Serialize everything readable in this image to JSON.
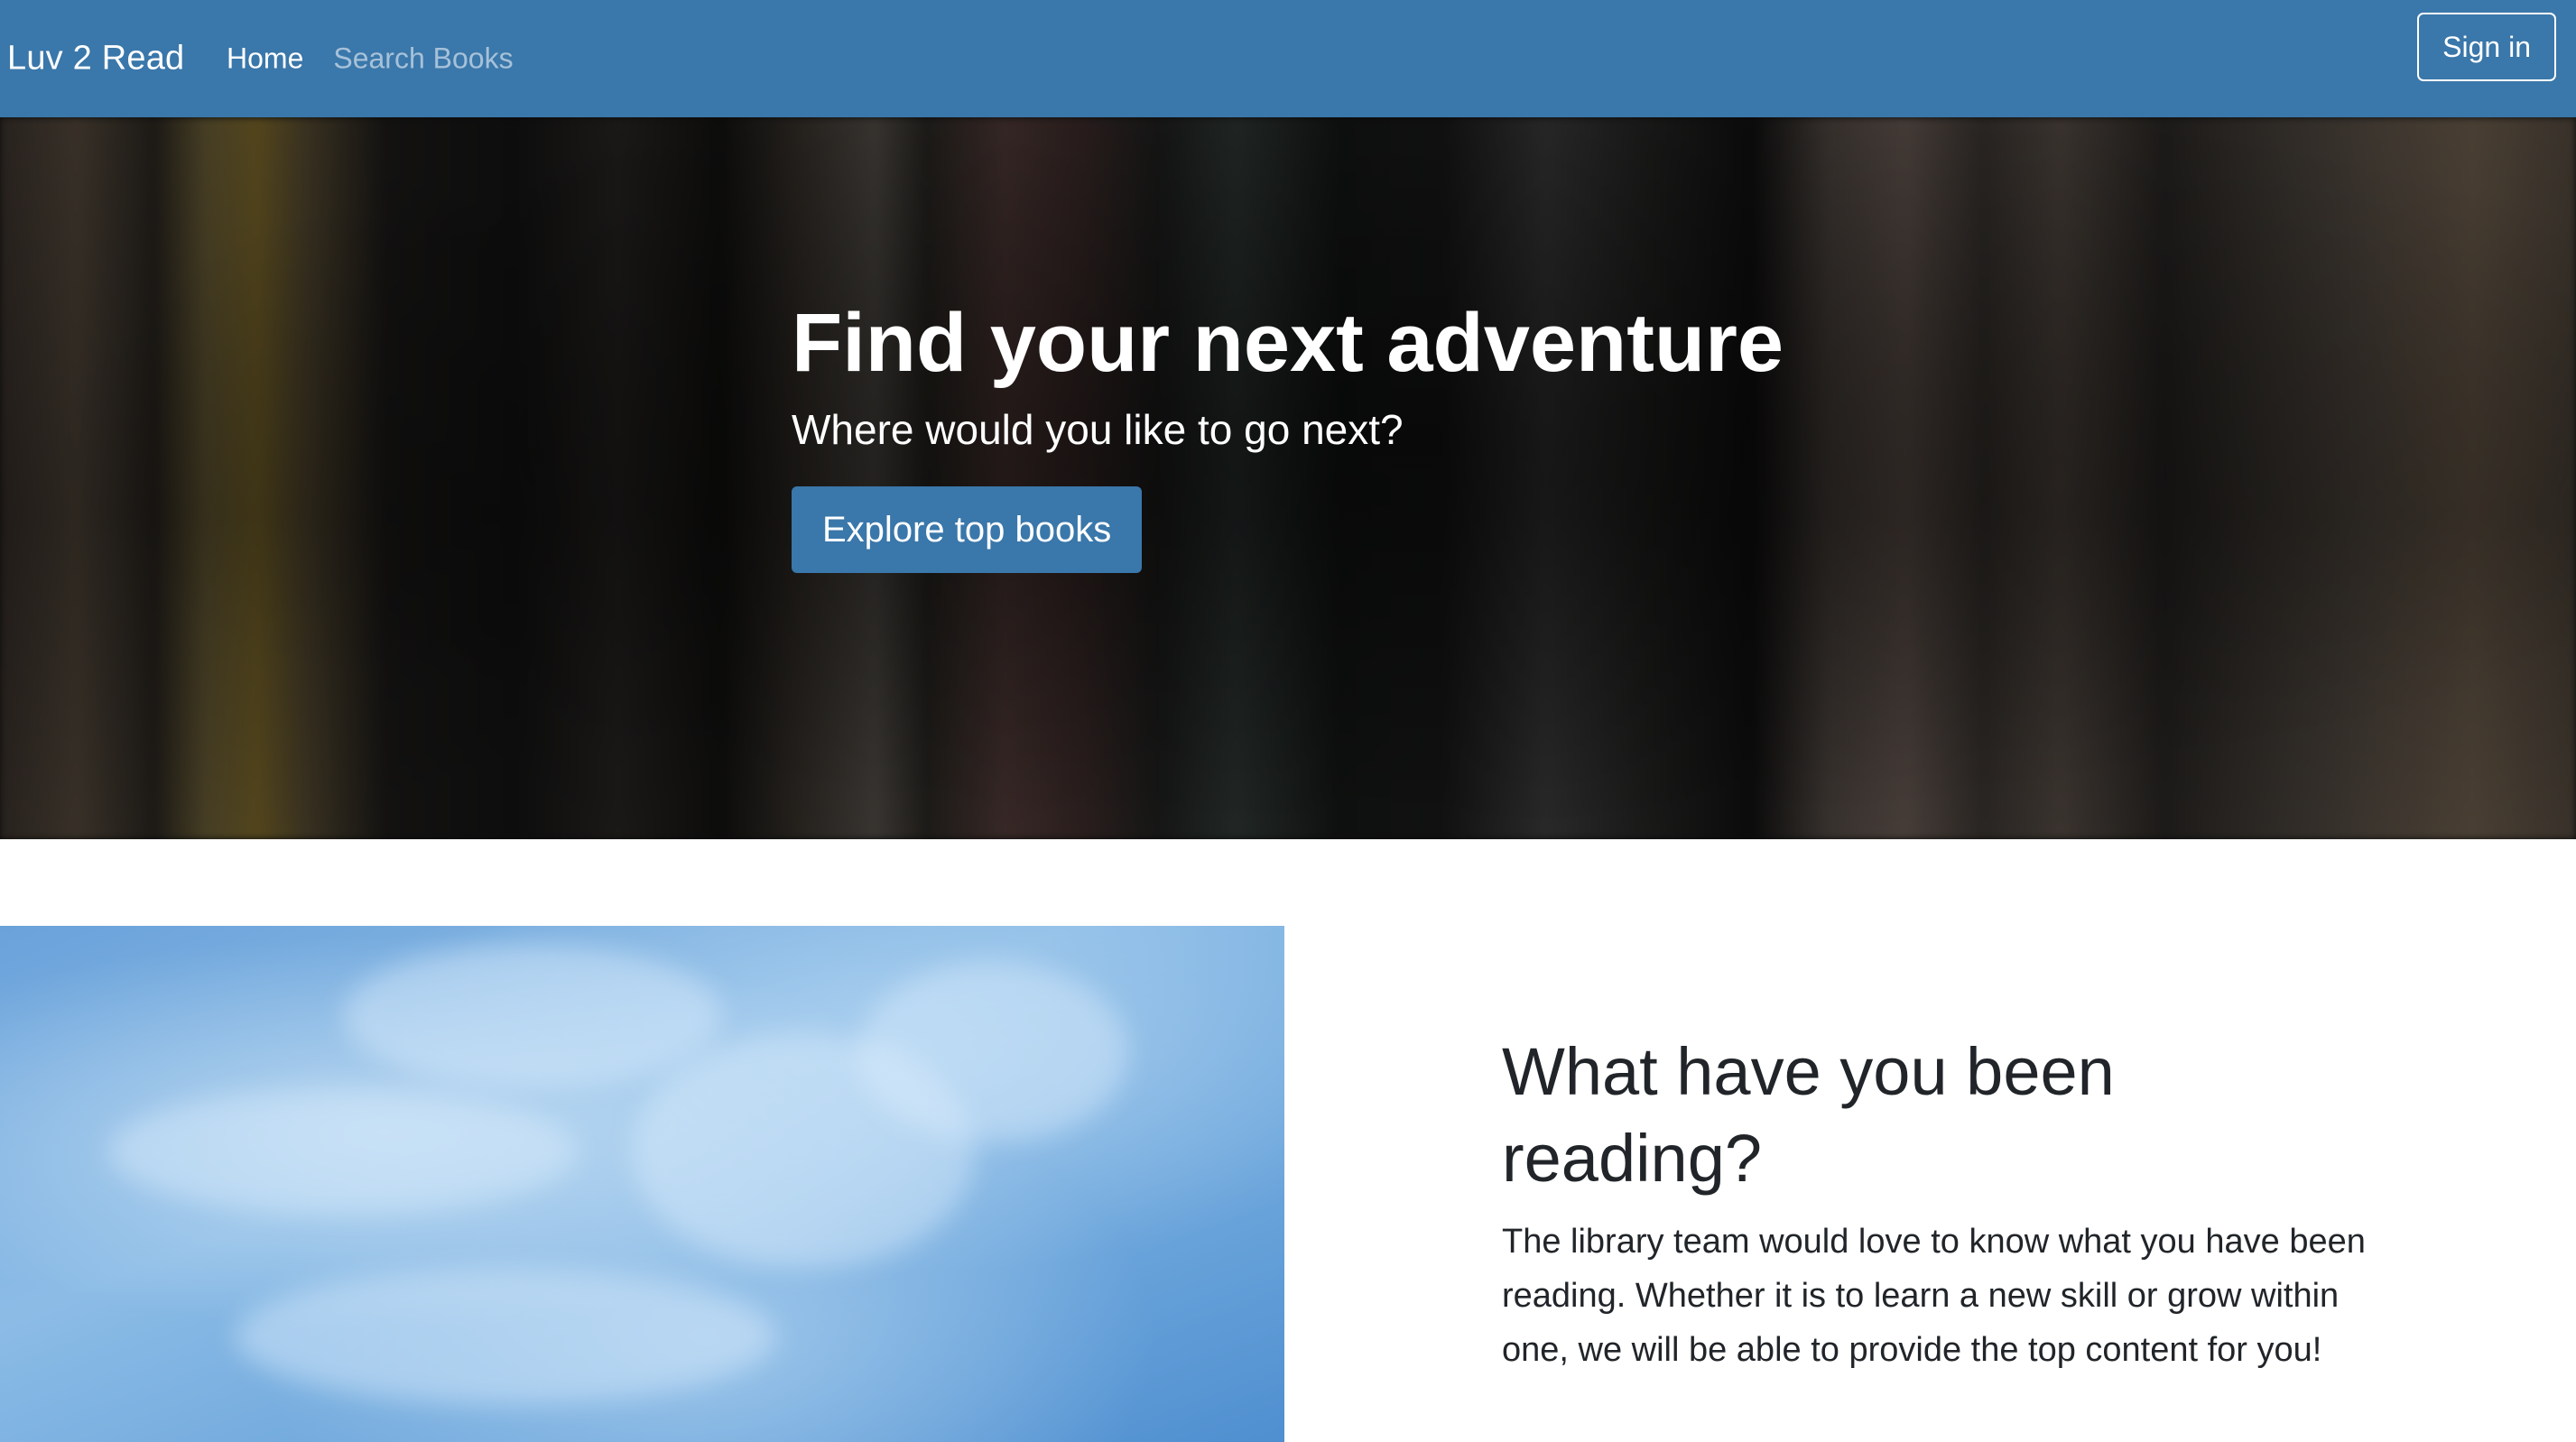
{
  "navbar": {
    "brand": "Luv 2 Read",
    "links": [
      {
        "label": "Home",
        "active": true
      },
      {
        "label": "Search Books",
        "active": false
      }
    ],
    "signin_label": "Sign in",
    "background_color": "#3a77aa"
  },
  "hero": {
    "title": "Find your next adventure",
    "subtitle": "Where would you like to go next?",
    "button_label": "Explore top books",
    "background_description_icon": "blurred-bookshelf-image"
  },
  "feature": {
    "image_icon": "sky-clouds-image",
    "title": "What have you been reading?",
    "body": "The library team would love to know what you have been reading. Whether it is to learn a new skill or grow within one, we will be able to provide the top content for you!"
  }
}
